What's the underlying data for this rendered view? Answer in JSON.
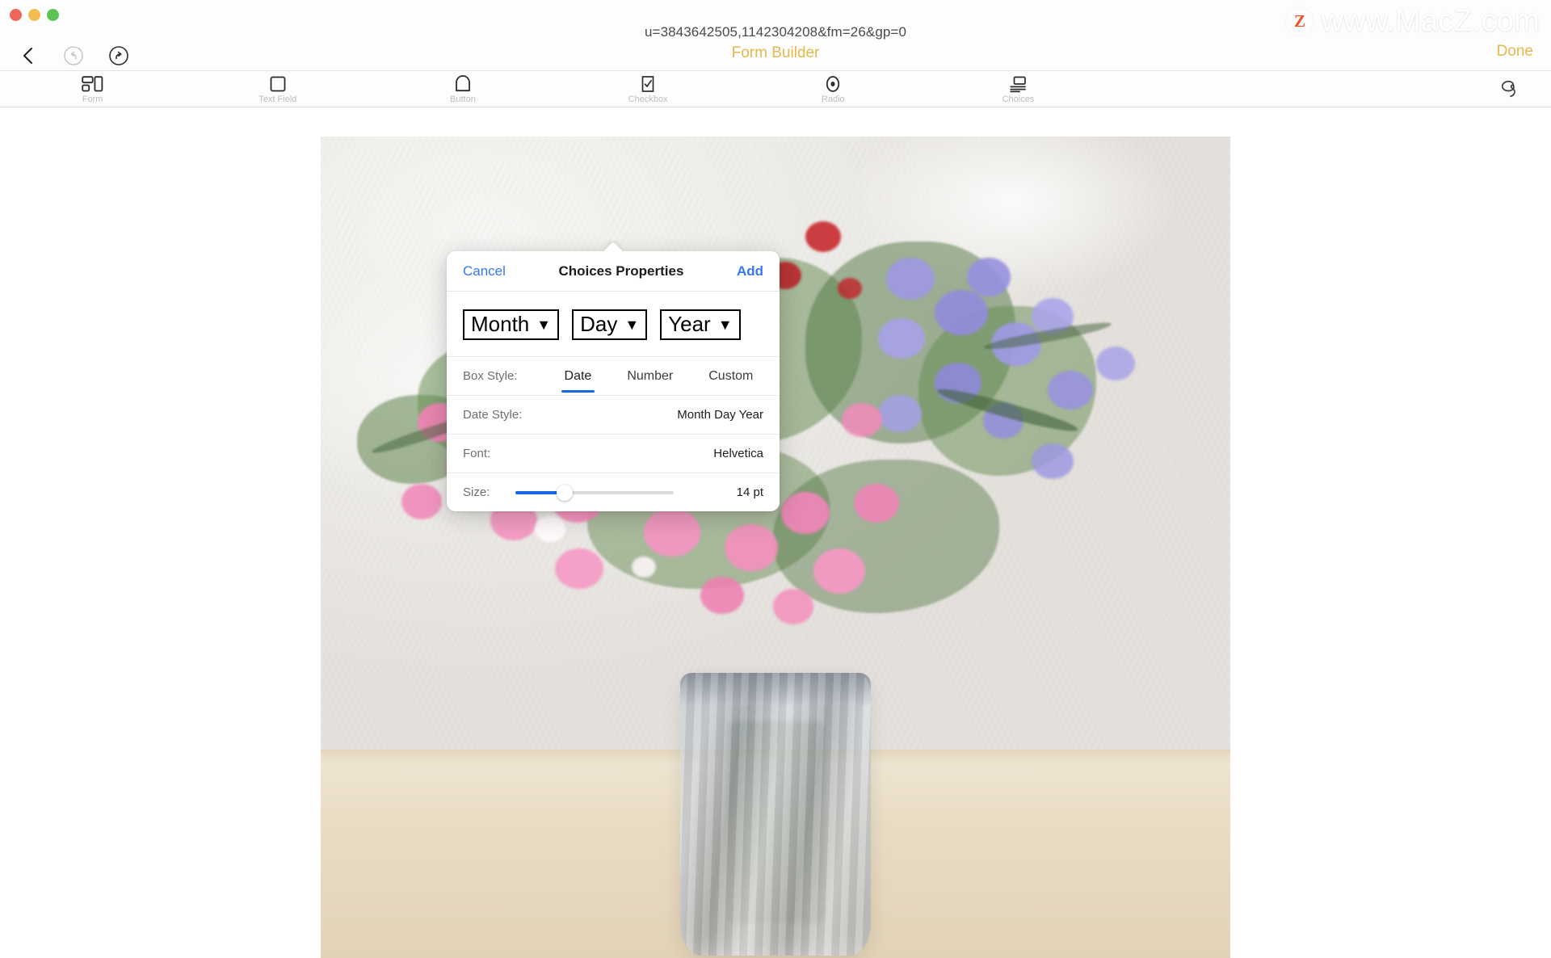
{
  "window": {
    "subtitle": "u=3843642505,1142304208&fm=26&gp=0",
    "title": "Form Builder",
    "done_label": "Done",
    "traffic_lights": [
      "close-button",
      "minimize-button",
      "maximize-button"
    ]
  },
  "watermark": {
    "badge": "Z",
    "text": "www.MacZ.com"
  },
  "nav": {
    "back": "back-chevron-icon",
    "undo": "undo-icon",
    "redo": "redo-icon"
  },
  "toolbar": {
    "items": [
      {
        "label": "Form",
        "icon": "form-layout-icon"
      },
      {
        "label": "Text Field",
        "icon": "square-icon"
      },
      {
        "label": "Button",
        "icon": "rounded-button-icon"
      },
      {
        "label": "Checkbox",
        "icon": "checkbox-icon"
      },
      {
        "label": "Radio",
        "icon": "radio-button-icon"
      },
      {
        "label": "Choices",
        "icon": "choices-list-icon"
      }
    ],
    "sign_icon": "signature-icon"
  },
  "popover": {
    "cancel_label": "Cancel",
    "title": "Choices Properties",
    "add_label": "Add",
    "preview": {
      "dropdowns": [
        {
          "label": "Month",
          "caret": "▼"
        },
        {
          "label": "Day",
          "caret": "▼"
        },
        {
          "label": "Year",
          "caret": "▼"
        }
      ]
    },
    "box_style": {
      "label": "Box Style:",
      "options": [
        "Date",
        "Number",
        "Custom"
      ],
      "selected": "Date"
    },
    "date_style": {
      "label": "Date Style:",
      "value": "Month Day Year"
    },
    "font": {
      "label": "Font:",
      "value": "Helvetica"
    },
    "size": {
      "label": "Size:",
      "value": "14 pt",
      "percent": 31
    }
  },
  "colors": {
    "accent_blue": "#3478f6",
    "selection_blue": "#1668e3",
    "title_gold": "#e6b84a",
    "watermark_orange": "#f0512a"
  }
}
